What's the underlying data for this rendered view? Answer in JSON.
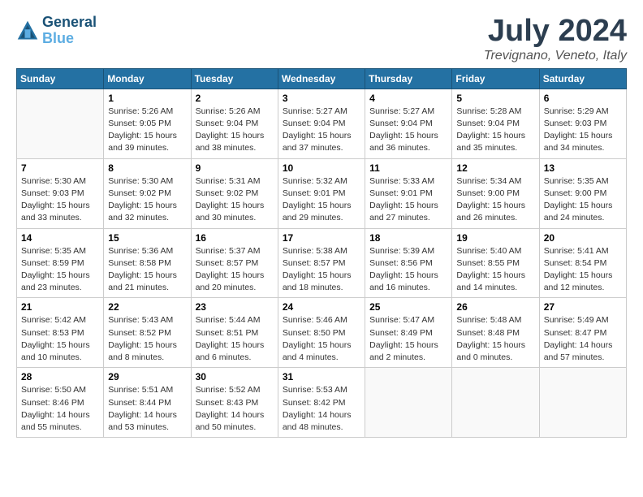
{
  "header": {
    "logo_line1": "General",
    "logo_line2": "Blue",
    "title": "July 2024",
    "subtitle": "Trevignano, Veneto, Italy"
  },
  "weekdays": [
    "Sunday",
    "Monday",
    "Tuesday",
    "Wednesday",
    "Thursday",
    "Friday",
    "Saturday"
  ],
  "weeks": [
    [
      {
        "day": "",
        "info": ""
      },
      {
        "day": "1",
        "info": "Sunrise: 5:26 AM\nSunset: 9:05 PM\nDaylight: 15 hours\nand 39 minutes."
      },
      {
        "day": "2",
        "info": "Sunrise: 5:26 AM\nSunset: 9:04 PM\nDaylight: 15 hours\nand 38 minutes."
      },
      {
        "day": "3",
        "info": "Sunrise: 5:27 AM\nSunset: 9:04 PM\nDaylight: 15 hours\nand 37 minutes."
      },
      {
        "day": "4",
        "info": "Sunrise: 5:27 AM\nSunset: 9:04 PM\nDaylight: 15 hours\nand 36 minutes."
      },
      {
        "day": "5",
        "info": "Sunrise: 5:28 AM\nSunset: 9:04 PM\nDaylight: 15 hours\nand 35 minutes."
      },
      {
        "day": "6",
        "info": "Sunrise: 5:29 AM\nSunset: 9:03 PM\nDaylight: 15 hours\nand 34 minutes."
      }
    ],
    [
      {
        "day": "7",
        "info": "Sunrise: 5:30 AM\nSunset: 9:03 PM\nDaylight: 15 hours\nand 33 minutes."
      },
      {
        "day": "8",
        "info": "Sunrise: 5:30 AM\nSunset: 9:02 PM\nDaylight: 15 hours\nand 32 minutes."
      },
      {
        "day": "9",
        "info": "Sunrise: 5:31 AM\nSunset: 9:02 PM\nDaylight: 15 hours\nand 30 minutes."
      },
      {
        "day": "10",
        "info": "Sunrise: 5:32 AM\nSunset: 9:01 PM\nDaylight: 15 hours\nand 29 minutes."
      },
      {
        "day": "11",
        "info": "Sunrise: 5:33 AM\nSunset: 9:01 PM\nDaylight: 15 hours\nand 27 minutes."
      },
      {
        "day": "12",
        "info": "Sunrise: 5:34 AM\nSunset: 9:00 PM\nDaylight: 15 hours\nand 26 minutes."
      },
      {
        "day": "13",
        "info": "Sunrise: 5:35 AM\nSunset: 9:00 PM\nDaylight: 15 hours\nand 24 minutes."
      }
    ],
    [
      {
        "day": "14",
        "info": "Sunrise: 5:35 AM\nSunset: 8:59 PM\nDaylight: 15 hours\nand 23 minutes."
      },
      {
        "day": "15",
        "info": "Sunrise: 5:36 AM\nSunset: 8:58 PM\nDaylight: 15 hours\nand 21 minutes."
      },
      {
        "day": "16",
        "info": "Sunrise: 5:37 AM\nSunset: 8:57 PM\nDaylight: 15 hours\nand 20 minutes."
      },
      {
        "day": "17",
        "info": "Sunrise: 5:38 AM\nSunset: 8:57 PM\nDaylight: 15 hours\nand 18 minutes."
      },
      {
        "day": "18",
        "info": "Sunrise: 5:39 AM\nSunset: 8:56 PM\nDaylight: 15 hours\nand 16 minutes."
      },
      {
        "day": "19",
        "info": "Sunrise: 5:40 AM\nSunset: 8:55 PM\nDaylight: 15 hours\nand 14 minutes."
      },
      {
        "day": "20",
        "info": "Sunrise: 5:41 AM\nSunset: 8:54 PM\nDaylight: 15 hours\nand 12 minutes."
      }
    ],
    [
      {
        "day": "21",
        "info": "Sunrise: 5:42 AM\nSunset: 8:53 PM\nDaylight: 15 hours\nand 10 minutes."
      },
      {
        "day": "22",
        "info": "Sunrise: 5:43 AM\nSunset: 8:52 PM\nDaylight: 15 hours\nand 8 minutes."
      },
      {
        "day": "23",
        "info": "Sunrise: 5:44 AM\nSunset: 8:51 PM\nDaylight: 15 hours\nand 6 minutes."
      },
      {
        "day": "24",
        "info": "Sunrise: 5:46 AM\nSunset: 8:50 PM\nDaylight: 15 hours\nand 4 minutes."
      },
      {
        "day": "25",
        "info": "Sunrise: 5:47 AM\nSunset: 8:49 PM\nDaylight: 15 hours\nand 2 minutes."
      },
      {
        "day": "26",
        "info": "Sunrise: 5:48 AM\nSunset: 8:48 PM\nDaylight: 15 hours\nand 0 minutes."
      },
      {
        "day": "27",
        "info": "Sunrise: 5:49 AM\nSunset: 8:47 PM\nDaylight: 14 hours\nand 57 minutes."
      }
    ],
    [
      {
        "day": "28",
        "info": "Sunrise: 5:50 AM\nSunset: 8:46 PM\nDaylight: 14 hours\nand 55 minutes."
      },
      {
        "day": "29",
        "info": "Sunrise: 5:51 AM\nSunset: 8:44 PM\nDaylight: 14 hours\nand 53 minutes."
      },
      {
        "day": "30",
        "info": "Sunrise: 5:52 AM\nSunset: 8:43 PM\nDaylight: 14 hours\nand 50 minutes."
      },
      {
        "day": "31",
        "info": "Sunrise: 5:53 AM\nSunset: 8:42 PM\nDaylight: 14 hours\nand 48 minutes."
      },
      {
        "day": "",
        "info": ""
      },
      {
        "day": "",
        "info": ""
      },
      {
        "day": "",
        "info": ""
      }
    ]
  ]
}
